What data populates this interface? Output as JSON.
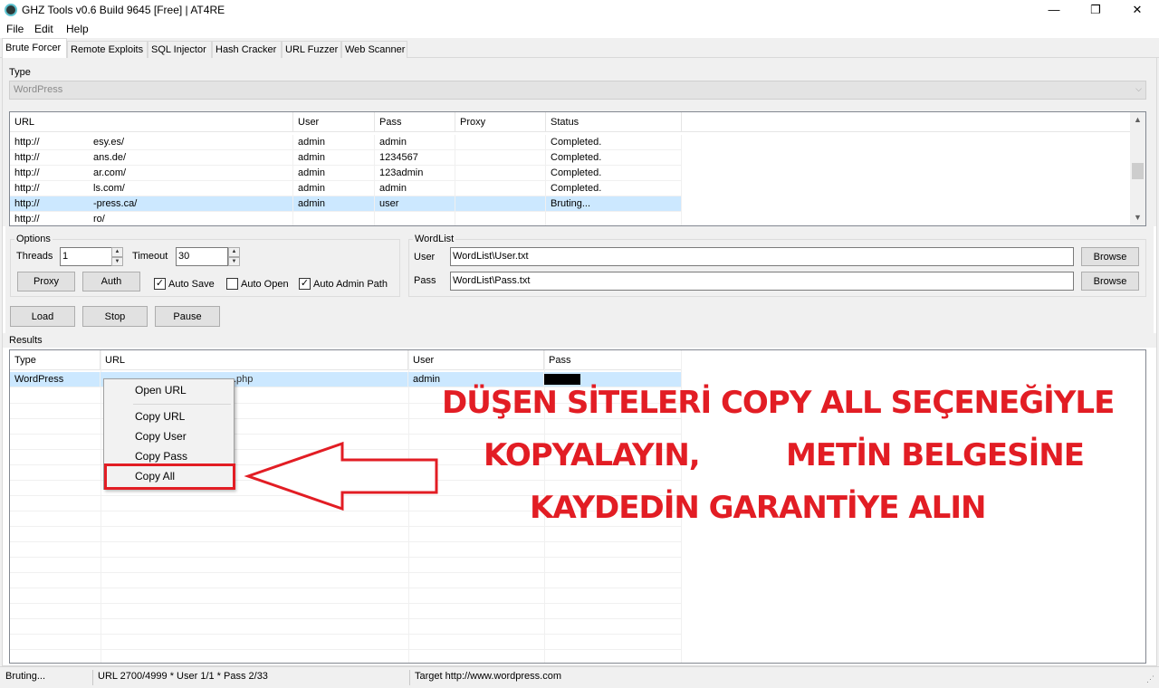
{
  "window": {
    "title": "GHZ Tools v0.6 Build 9645 [Free] | AT4RE",
    "min": "—",
    "max": "❐",
    "close": "✕"
  },
  "menu": [
    "File",
    "Edit",
    "Help"
  ],
  "tabs": [
    "Brute Forcer",
    "Remote Exploits",
    "SQL Injector",
    "Hash Cracker",
    "URL Fuzzer",
    "Web Scanner"
  ],
  "type_section": {
    "label": "Type",
    "value": "WordPress"
  },
  "targets": {
    "columns": [
      "URL",
      "User",
      "Pass",
      "Proxy",
      "Status"
    ],
    "rows": [
      {
        "url_a": "http://",
        "url_b": "esy.es/",
        "user": "admin",
        "pass": "admin",
        "proxy": "",
        "status": "Completed."
      },
      {
        "url_a": "http://",
        "url_b": "ans.de/",
        "user": "admin",
        "pass": "1234567",
        "proxy": "",
        "status": "Completed."
      },
      {
        "url_a": "http://",
        "url_b": "ar.com/",
        "user": "admin",
        "pass": "123admin",
        "proxy": "",
        "status": "Completed."
      },
      {
        "url_a": "http://",
        "url_b": "ls.com/",
        "user": "admin",
        "pass": "admin",
        "proxy": "",
        "status": "Completed."
      },
      {
        "url_a": "http://",
        "url_b": "-press.ca/",
        "user": "admin",
        "pass": "user",
        "proxy": "",
        "status": "Bruting..."
      },
      {
        "url_a": "http://",
        "url_b": "ro/",
        "user": "",
        "pass": "",
        "proxy": "",
        "status": ""
      }
    ]
  },
  "options": {
    "title": "Options",
    "threads_label": "Threads",
    "threads_value": "1",
    "timeout_label": "Timeout",
    "timeout_value": "30",
    "proxy_button": "Proxy",
    "auth_button": "Auth",
    "auto_save": {
      "label": "Auto Save",
      "checked": true
    },
    "auto_open": {
      "label": "Auto Open",
      "checked": false
    },
    "auto_admin_path": {
      "label": "Auto Admin Path",
      "checked": true
    }
  },
  "wordlist": {
    "title": "WordList",
    "user_label": "User",
    "user_value": "WordList\\User.txt",
    "pass_label": "Pass",
    "pass_value": "WordList\\Pass.txt",
    "browse_label": "Browse"
  },
  "actions": {
    "load": "Load",
    "stop": "Stop",
    "pause": "Pause"
  },
  "results": {
    "label": "Results",
    "columns": [
      "Type",
      "URL",
      "User",
      "Pass"
    ],
    "rows": [
      {
        "type": "WordPress",
        "url": "http://bilintlogan/.../wp-login.php",
        "url_tail": ".php",
        "user": "admin",
        "pass": ""
      }
    ]
  },
  "context_menu": [
    "Open URL",
    "Copy URL",
    "Copy User",
    "Copy Pass",
    "Copy All"
  ],
  "annotation": {
    "line1": "DÜŞEN SİTELERİ COPY ALL SEÇENEĞİYLE",
    "line2a": "KOPYALAYIN,",
    "line2b": "METİN BELGESİNE",
    "line3": "KAYDEDİN  GARANTİYE ALIN",
    "color": "#e21d24"
  },
  "status": {
    "state": "Bruting...",
    "progress": "URL 2700/4999 * User 1/1 * Pass 2/33",
    "target": "Target http://www.wordpress.com"
  }
}
